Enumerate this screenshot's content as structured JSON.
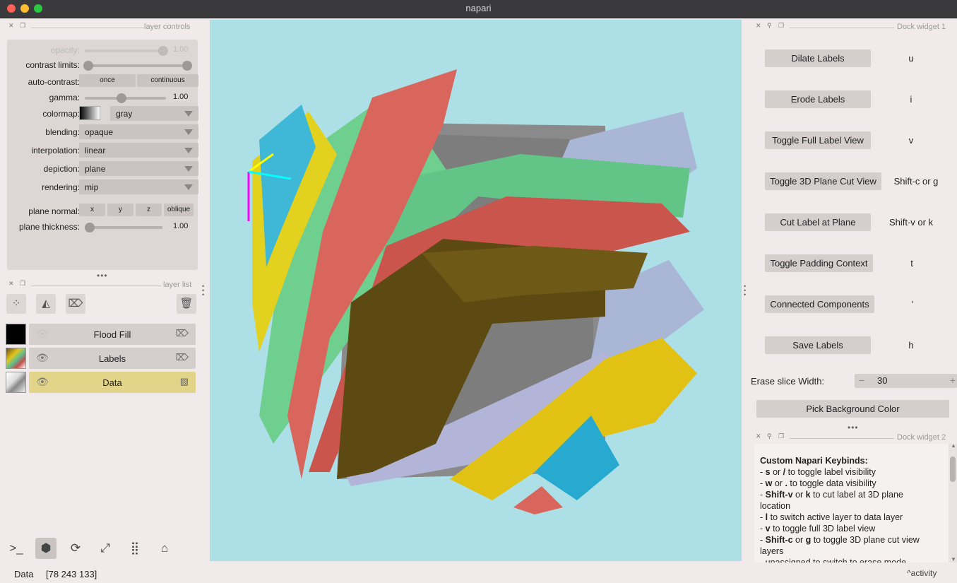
{
  "window": {
    "title": "napari"
  },
  "layer_controls": {
    "title": "layer controls",
    "opacity": {
      "label": "opacity:",
      "value": "1.00"
    },
    "contrast_limits": {
      "label": "contrast limits:"
    },
    "auto_contrast": {
      "label": "auto-contrast:",
      "once": "once",
      "continuous": "continuous"
    },
    "gamma": {
      "label": "gamma:",
      "value": "1.00"
    },
    "colormap": {
      "label": "colormap:",
      "value": "gray"
    },
    "blending": {
      "label": "blending:",
      "value": "opaque"
    },
    "interpolation": {
      "label": "interpolation:",
      "value": "linear"
    },
    "depiction": {
      "label": "depiction:",
      "value": "plane"
    },
    "rendering": {
      "label": "rendering:",
      "value": "mip"
    },
    "plane_normal": {
      "label": "plane normal:",
      "x": "x",
      "y": "y",
      "z": "z",
      "oblique": "oblique"
    },
    "plane_thickness": {
      "label": "plane thickness:",
      "value": "1.00"
    },
    "levels": {
      "opacity": 1.0,
      "gamma": 0.45,
      "plane_thickness": 0.0
    }
  },
  "layer_list": {
    "title": "layer list",
    "layers": [
      {
        "name": "Flood Fill",
        "visible": false,
        "icon": "tag-icon"
      },
      {
        "name": "Labels",
        "visible": true,
        "icon": "tag-icon"
      },
      {
        "name": "Data",
        "visible": true,
        "icon": "image-icon",
        "selected": true
      }
    ]
  },
  "status": {
    "layer": "Data",
    "coords": "[78 243 133]",
    "activity": "activity"
  },
  "dock1": {
    "title": "Dock widget 1",
    "buttons": [
      {
        "label": "Dilate Labels",
        "key": "u"
      },
      {
        "label": "Erode Labels",
        "key": "i"
      },
      {
        "label": "Toggle Full Label View",
        "key": "v"
      },
      {
        "label": "Toggle 3D Plane Cut View",
        "key": "Shift-c or g"
      },
      {
        "label": "Cut Label at Plane",
        "key": "Shift-v or k"
      },
      {
        "label": "Toggle Padding Context",
        "key": "t"
      },
      {
        "label": "Connected Components",
        "key": "'"
      },
      {
        "label": "Save Labels",
        "key": "h"
      }
    ],
    "erase_label": "Erase slice Width:",
    "erase_value": "30",
    "erase_minus": "−",
    "erase_plus": "+",
    "pick_bg": "Pick Background Color"
  },
  "dock2": {
    "title": "Dock widget 2",
    "heading": "Custom Napari Keybinds:",
    "lines": [
      {
        "pre": "- ",
        "b1": "s",
        "mid": " or ",
        "b2": "/",
        "post": " to toggle label visibility"
      },
      {
        "pre": "- ",
        "b1": "w",
        "mid": " or ",
        "b2": ".",
        "post": " to toggle data visibility"
      },
      {
        "pre": "- ",
        "b1": "Shift-v",
        "mid": " or ",
        "b2": "k",
        "post": " to cut label at 3D plane"
      },
      {
        "pre": "location",
        "b1": "",
        "mid": "",
        "b2": "",
        "post": ""
      },
      {
        "pre": "- ",
        "b1": "l",
        "mid": " to switch active layer to data layer",
        "b2": "",
        "post": ""
      },
      {
        "pre": "- ",
        "b1": "v",
        "mid": " to toggle full 3D label view",
        "b2": "",
        "post": ""
      },
      {
        "pre": "- ",
        "b1": "Shift-c",
        "mid": " or ",
        "b2": "g",
        "post": " to toggle 3D plane cut view"
      },
      {
        "pre": "layers",
        "b1": "",
        "mid": "",
        "b2": "",
        "post": ""
      },
      {
        "pre": "- unassigned to switch to erase mode",
        "b1": "",
        "mid": "",
        "b2": "",
        "post": ""
      }
    ]
  },
  "colors": {
    "canvas_bg": "#acdfe6",
    "selected_layer": "#e2d58a"
  }
}
